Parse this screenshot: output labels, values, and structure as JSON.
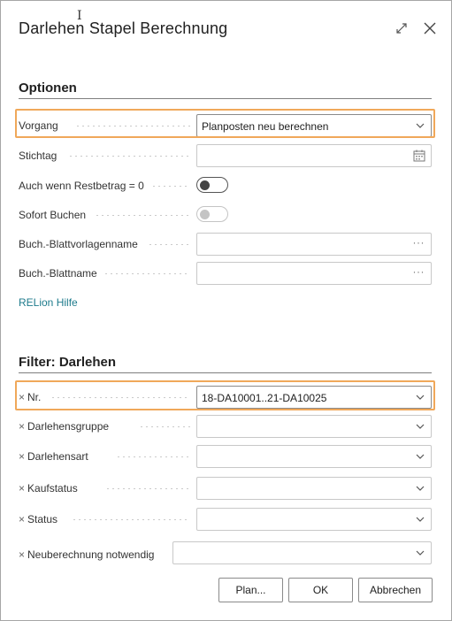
{
  "dialog": {
    "title": "Darlehen Stapel Berechnung",
    "cursor_glyph": "I"
  },
  "optionen": {
    "heading": "Optionen",
    "vorgang": {
      "label": "Vorgang",
      "value": "Planposten neu berechnen"
    },
    "stichtag": {
      "label": "Stichtag",
      "value": ""
    },
    "auch_wenn": {
      "label": "Auch wenn Restbetrag = 0",
      "on": false
    },
    "sofort_buchen": {
      "label": "Sofort Buchen",
      "on": false,
      "disabled": true
    },
    "blattvorlage": {
      "label": "Buch.-Blattvorlagenname",
      "value": "",
      "ellipsis": "···"
    },
    "blattname": {
      "label": "Buch.-Blattname",
      "value": "",
      "ellipsis": "···"
    },
    "help_link": "RELion Hilfe"
  },
  "filter": {
    "heading": "Filter: Darlehen",
    "remove_glyph": "×",
    "fields": [
      {
        "label": "Nr.",
        "value": "18-DA10001..21-DA10025"
      },
      {
        "label": "Darlehensgruppe",
        "value": ""
      },
      {
        "label": "Darlehensart",
        "value": ""
      },
      {
        "label": "Kaufstatus",
        "value": ""
      },
      {
        "label": "Status",
        "value": ""
      },
      {
        "label": "Neuberechnung notwendig",
        "value": ""
      }
    ]
  },
  "footer": {
    "plan": "Plan...",
    "ok": "OK",
    "cancel": "Abbrechen"
  },
  "colors": {
    "highlight": "#f0a85a",
    "link": "#1e7b8c"
  }
}
